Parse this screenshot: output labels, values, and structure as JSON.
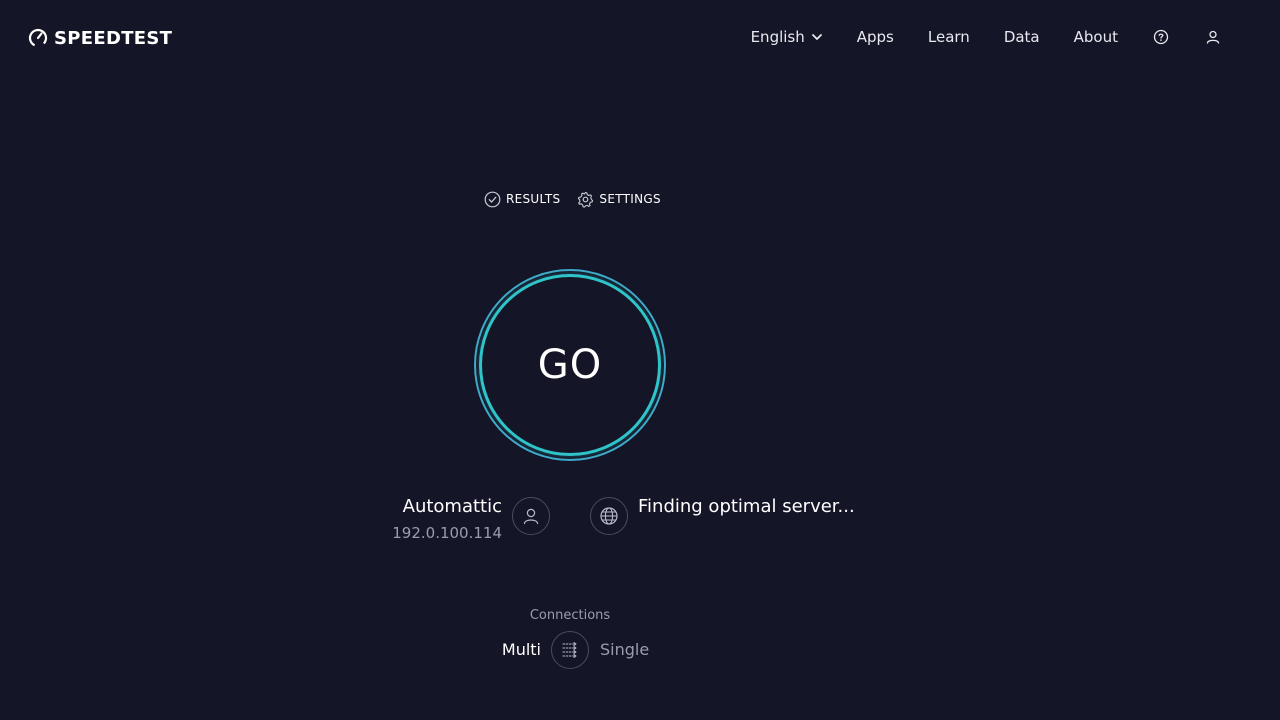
{
  "header": {
    "logo_text": "SPEEDTEST",
    "nav": {
      "language": "English",
      "apps": "Apps",
      "learn": "Learn",
      "data": "Data",
      "about": "About"
    },
    "icons": [
      "chevron-down-icon",
      "help-icon",
      "user-icon"
    ]
  },
  "toolbar": {
    "results_label": "RESULTS",
    "settings_label": "SETTINGS"
  },
  "go_button": {
    "label": "GO"
  },
  "provider": {
    "name": "Automattic",
    "ip": "192.0.100.114"
  },
  "server": {
    "status": "Finding optimal server..."
  },
  "connections": {
    "label": "Connections",
    "multi": "Multi",
    "single": "Single",
    "selected": "Multi"
  },
  "colors": {
    "background": "#141526",
    "ring_outer": "#3fa9c9",
    "ring_inner": "#2ec4c9",
    "muted_text": "#9a9cb0"
  }
}
